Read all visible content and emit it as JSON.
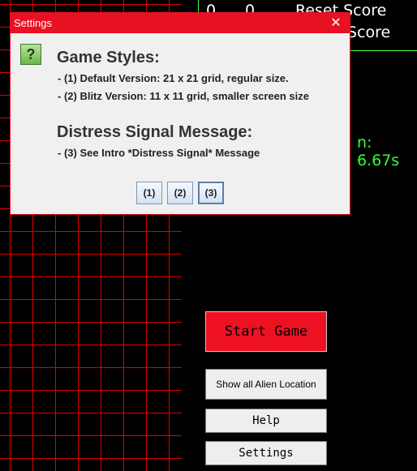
{
  "scoreboard": {
    "line1_left": "0",
    "line1_mid": "0",
    "line1_right": "Reset Score",
    "line2_right": "Score",
    "timer": "n: 6.67s"
  },
  "buttons": {
    "start": "Start Game",
    "aliens": "Show all Alien Location",
    "help": "Help",
    "settings": "Settings"
  },
  "dialog": {
    "title": "Settings",
    "close": "✕",
    "icon": "?",
    "heading1": "Game Styles:",
    "line1": "- (1) Default Version: 21 x 21 grid, regular size.",
    "line2": "- (2) Blitz Version: 11 x 11 grid, smaller screen size",
    "heading2": "Distress Signal Message:",
    "line3": "- (3) See Intro *Distress Signal* Message",
    "options": [
      "(1)",
      "(2)",
      "(3)"
    ]
  },
  "colors": {
    "grid": "#e00000",
    "titlebar": "#e81123",
    "start_button": "#ee1122",
    "timer": "#33ff33"
  }
}
